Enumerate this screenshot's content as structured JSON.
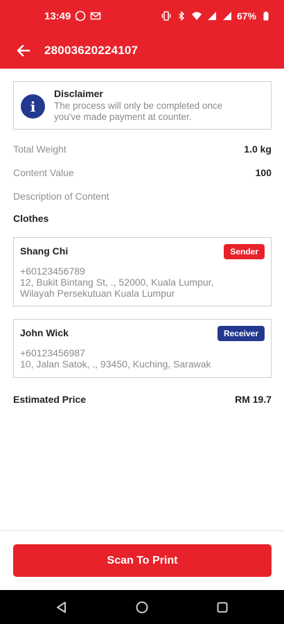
{
  "status_bar": {
    "time": "13:49",
    "battery": "67%"
  },
  "header": {
    "title": "28003620224107"
  },
  "disclaimer": {
    "title": "Disclaimer",
    "body_line1": "The process will only be completed once",
    "body_line2": "you've made payment at counter."
  },
  "details": {
    "total_weight_label": "Total Weight",
    "total_weight_value": "1.0 kg",
    "content_value_label": "Content Value",
    "content_value_value": "100",
    "description_label": "Description of Content",
    "description_value": "Clothes"
  },
  "sender": {
    "name": "Shang Chi",
    "badge": "Sender",
    "phone": "+60123456789",
    "address_line1": "12, Bukit Bintang St, ., 52000, Kuala Lumpur,",
    "address_line2": "Wilayah Persekutuan Kuala Lumpur"
  },
  "receiver": {
    "name": "John Wick",
    "badge": "Receiver",
    "phone": "+60123456987",
    "address_line1": "10, Jalan Satok, ., 93450, Kuching, Sarawak"
  },
  "estimate": {
    "label": "Estimated Price",
    "value": "RM 19.7"
  },
  "actions": {
    "primary_label": "Scan To Print"
  },
  "colors": {
    "brand_red": "#e8222a",
    "brand_blue": "#23398f"
  }
}
